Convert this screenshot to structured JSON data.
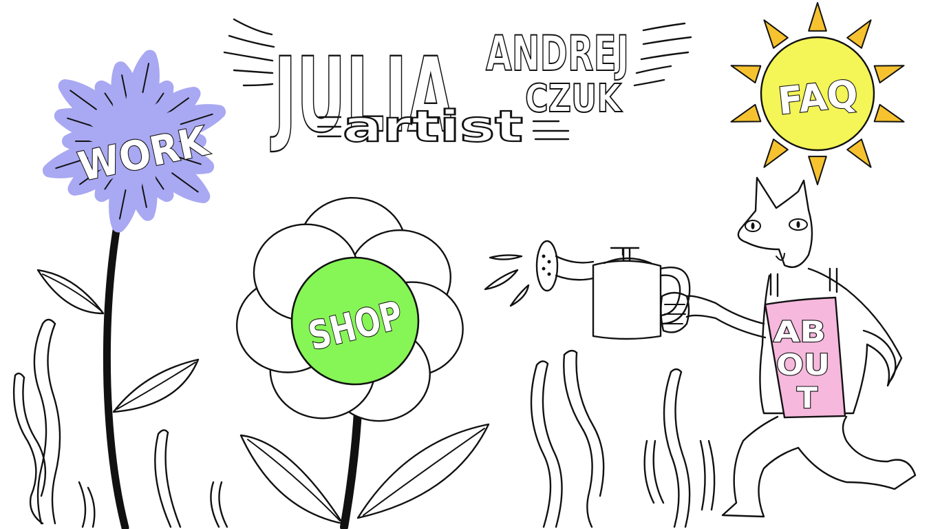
{
  "header": {
    "first_name": "JULIA",
    "last_name_part1": "ANDREJ",
    "last_name_part2": "CZUK",
    "subtitle": "artist"
  },
  "nav": {
    "work_label": "WORK",
    "shop_label": "SHOP",
    "faq_label": "FAQ",
    "about_label_line1": "AB",
    "about_label_line2": "OU",
    "about_label_line3": "T"
  },
  "colors": {
    "work_flower": "#a9a8f2",
    "shop_center": "#86f556",
    "sun_face": "#f4f556",
    "sun_rays": "#f6c22f",
    "apron": "#f6b8dc",
    "ink": "#111111"
  }
}
